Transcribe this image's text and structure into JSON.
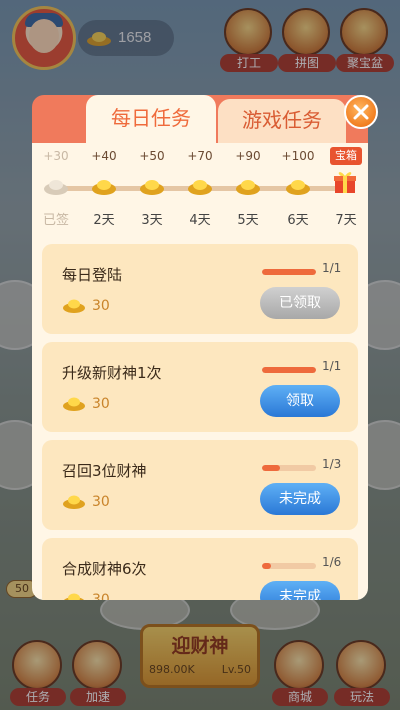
{
  "hud": {
    "coins": "1658",
    "top_buttons": [
      {
        "icon": "work-icon",
        "label": "打工"
      },
      {
        "icon": "puzzle-icon",
        "label": "拼图"
      },
      {
        "icon": "treasure-pot-icon",
        "label": "聚宝盆"
      }
    ],
    "bottom_buttons": [
      {
        "icon": "task-scroll-icon",
        "label": "任务"
      },
      {
        "icon": "rocket-icon",
        "label": "加速"
      },
      {
        "icon": "shop-icon",
        "label": "商城"
      },
      {
        "icon": "gameplay-icon",
        "label": "玩法"
      }
    ],
    "summon": {
      "label": "迎财神",
      "cost": "898.00K",
      "level": "Lv.50"
    },
    "side_badge": "50"
  },
  "dialog": {
    "tabs": [
      {
        "label": "每日任务",
        "active": true
      },
      {
        "label": "游戏任务",
        "active": false
      }
    ],
    "treasure_label": "宝箱",
    "checkin": [
      {
        "reward": "+30",
        "day": "已签",
        "done": true
      },
      {
        "reward": "+40",
        "day": "2天",
        "done": false
      },
      {
        "reward": "+50",
        "day": "3天",
        "done": false
      },
      {
        "reward": "+70",
        "day": "4天",
        "done": false
      },
      {
        "reward": "+90",
        "day": "5天",
        "done": false
      },
      {
        "reward": "+100",
        "day": "6天",
        "done": false
      },
      {
        "reward": "",
        "day": "7天",
        "done": false,
        "gift": true
      }
    ],
    "tasks": [
      {
        "title": "每日登陆",
        "reward": "30",
        "progress_text": "1/1",
        "progress": 1.0,
        "button": "已领取",
        "button_state": "claimed"
      },
      {
        "title": "升级新财神1次",
        "reward": "30",
        "progress_text": "1/1",
        "progress": 1.0,
        "button": "领取",
        "button_state": "claim"
      },
      {
        "title": "召回3位财神",
        "reward": "30",
        "progress_text": "1/3",
        "progress": 0.33,
        "button": "未完成",
        "button_state": "incomplete"
      },
      {
        "title": "合成财神6次",
        "reward": "30",
        "progress_text": "1/6",
        "progress": 0.17,
        "button": "未完成",
        "button_state": "incomplete"
      }
    ]
  },
  "colors": {
    "accent": "#ef6a3b",
    "panel": "#fff6e6",
    "card": "#fde7bf",
    "button_blue": "#2a78d6"
  }
}
